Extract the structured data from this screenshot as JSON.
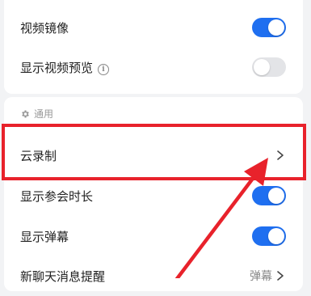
{
  "settings_top": {
    "mirror_video": {
      "label": "视频镜像",
      "enabled": true
    },
    "show_video_preview": {
      "label": "显示视频预览",
      "enabled": false
    }
  },
  "general": {
    "section_title": "通用",
    "cloud_recording": {
      "label": "云录制"
    },
    "show_meeting_duration": {
      "label": "显示参会时长",
      "enabled": true
    },
    "show_danmaku": {
      "label": "显示弹幕",
      "enabled": true
    },
    "new_chat_reminder": {
      "label": "新聊天消息提醒",
      "value": "弹幕"
    }
  },
  "annotation": {
    "highlight_color": "#e8222b"
  },
  "colors": {
    "toggle_on": "#1f6ff0",
    "toggle_off": "#e3e4e7",
    "background": "#f2f3f5"
  }
}
